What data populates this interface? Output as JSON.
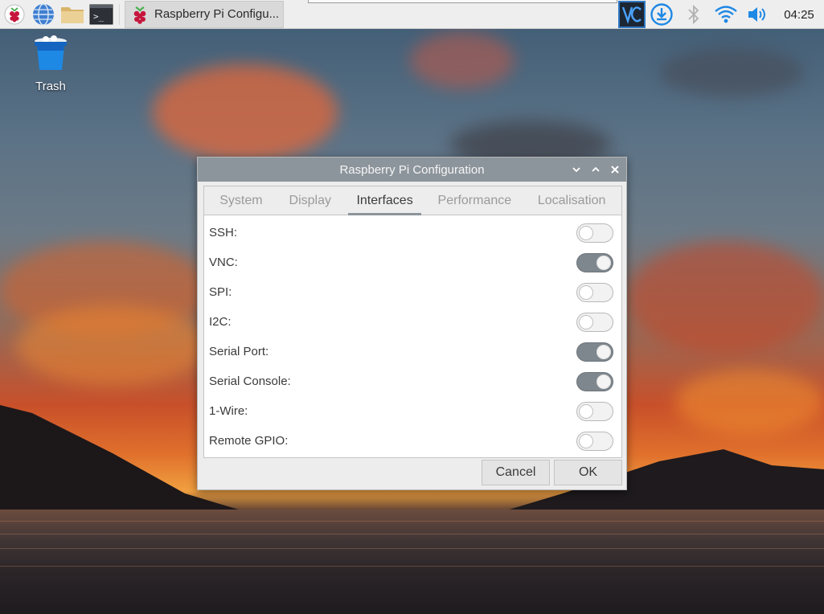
{
  "taskbar": {
    "launchers": [
      {
        "icon": "raspberry-menu-icon"
      },
      {
        "icon": "web-browser-icon"
      },
      {
        "icon": "file-manager-icon"
      },
      {
        "icon": "terminal-icon"
      }
    ],
    "task": {
      "icon": "raspberry-pi-icon",
      "label": "Raspberry Pi Configu..."
    },
    "tray": {
      "vnc_icon": "vnc-server-icon",
      "update_icon": "download-update-icon",
      "bluetooth_icon": "bluetooth-icon",
      "wifi_icon": "wifi-icon",
      "volume_icon": "volume-icon",
      "clock": "04:25"
    }
  },
  "desktop": {
    "icons": [
      {
        "label": "Trash",
        "icon": "trash-icon"
      }
    ]
  },
  "dialog": {
    "title": "Raspberry Pi Configuration",
    "tabs": [
      {
        "label": "System",
        "active": false
      },
      {
        "label": "Display",
        "active": false
      },
      {
        "label": "Interfaces",
        "active": true
      },
      {
        "label": "Performance",
        "active": false
      },
      {
        "label": "Localisation",
        "active": false
      }
    ],
    "interfaces": [
      {
        "label": "SSH:",
        "enabled": false
      },
      {
        "label": "VNC:",
        "enabled": true
      },
      {
        "label": "SPI:",
        "enabled": false
      },
      {
        "label": "I2C:",
        "enabled": false
      },
      {
        "label": "Serial Port:",
        "enabled": true
      },
      {
        "label": "Serial Console:",
        "enabled": true
      },
      {
        "label": "1-Wire:",
        "enabled": false
      },
      {
        "label": "Remote GPIO:",
        "enabled": false
      }
    ],
    "buttons": {
      "cancel": "Cancel",
      "ok": "OK"
    }
  },
  "colors": {
    "titlebar": "#8d959c",
    "switch_on": "#7f878e",
    "vnc_highlight": "#2f78c4",
    "tray_accent": "#1e88e5"
  }
}
